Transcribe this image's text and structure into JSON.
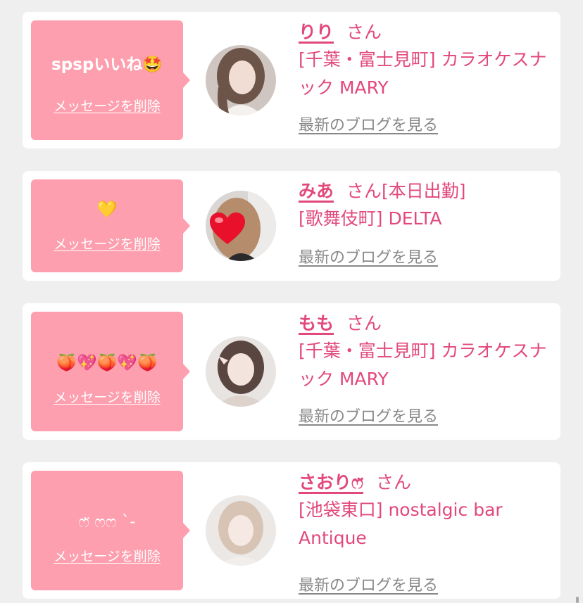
{
  "colors": {
    "accent": "#e2487a",
    "bubble": "#fd9fae",
    "link_gray": "#888888",
    "background": "#efefef"
  },
  "cards": [
    {
      "message": "spspいいね🤩",
      "delete_label": "メッセージを削除",
      "name": "りり",
      "honorific": "さん",
      "status": "",
      "shop": "[千葉・富士見町] カラオケスナック MARY",
      "blog_label": "最新のブログを見る"
    },
    {
      "message": "💛",
      "delete_label": "メッセージを削除",
      "name": "みあ",
      "honorific": "さん",
      "status": "[本日出勤]",
      "shop": "[歌舞伎町] DELTA",
      "blog_label": "最新のブログを見る"
    },
    {
      "message": "🍑💖🍑💖🍑",
      "delete_label": "メッセージを削除",
      "name": "もも",
      "honorific": "さん",
      "status": "",
      "shop": "[千葉・富士見町] カラオケスナック MARY",
      "blog_label": "最新のブログを見る"
    },
    {
      "message": "ෆ̈ ෆෆ ˋ-",
      "delete_label": "メッセージを削除",
      "name": "さおりෆ̈",
      "honorific": "さん",
      "status": "",
      "shop": "[池袋東口] nostalgic bar Antique",
      "blog_label": "最新のブログを見る"
    }
  ]
}
